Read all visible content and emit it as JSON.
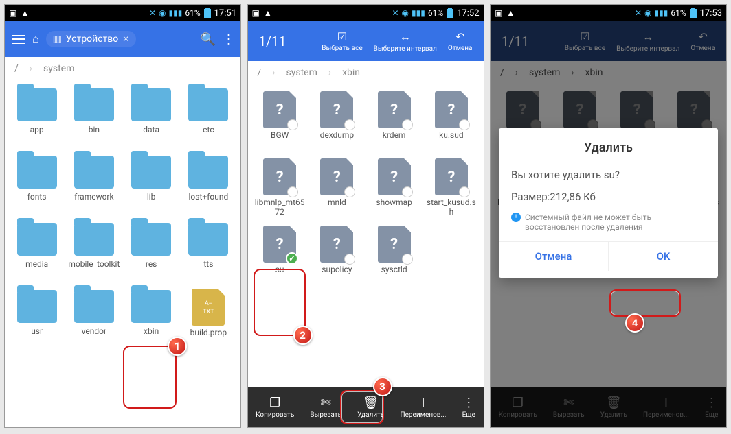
{
  "status": {
    "battery": "61%",
    "t1": "17:51",
    "t2": "17:52",
    "t3": "17:53"
  },
  "p1": {
    "device_label": "Устройство",
    "crumbs": [
      "/",
      "system"
    ],
    "items": [
      "app",
      "bin",
      "data",
      "etc",
      "fonts",
      "framework",
      "lib",
      "lost+found",
      "media",
      "mobile_toolkit",
      "res",
      "tts",
      "usr",
      "vendor",
      "xbin"
    ],
    "docfile": "build.prop",
    "doc_badge": "TXT"
  },
  "p2": {
    "count": "1/11",
    "actions": {
      "all": "Выбрать все",
      "range": "Выберите интервал",
      "cancel": "Отмена"
    },
    "crumbs": [
      "/",
      "system",
      "xbin"
    ],
    "files": [
      "BGW",
      "dexdump",
      "krdem",
      "ku.sud",
      "libmnlp_mt6572",
      "mnld",
      "showmap",
      "start_kusud.sh",
      "su",
      "supolicy",
      "sysctld"
    ],
    "selected_index": 8,
    "bottom": {
      "copy": "Копировать",
      "cut": "Вырезать",
      "del": "Удалить",
      "ren": "Переименов...",
      "more": "Еще"
    }
  },
  "p3": {
    "count": "1/11",
    "actions": {
      "all": "Выбрать все",
      "range": "Выберите интервал",
      "cancel": "Отмена"
    },
    "crumbs": [
      "/",
      "system",
      "xbin"
    ],
    "dialog": {
      "title": "Удалить",
      "msg": "Вы хотите удалить su?",
      "size": "Размер:212,86 Кб",
      "note": "Системный файл не может быть восстановлен после удаления",
      "cancel": "Отмена",
      "ok": "OK"
    },
    "bottom": {
      "copy": "Копировать",
      "cut": "Вырезать",
      "del": "Удалить",
      "ren": "Переименов...",
      "more": "Еще"
    }
  }
}
